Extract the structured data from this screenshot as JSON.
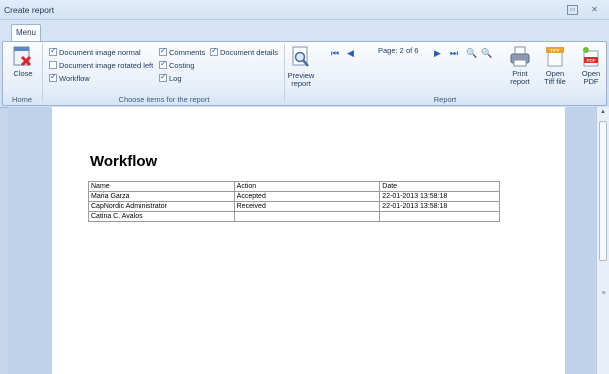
{
  "window": {
    "title": "Create report"
  },
  "ribbon_tabs": [
    {
      "label": "Menu"
    }
  ],
  "home_group": {
    "close_label": "Close",
    "group_label": "Home"
  },
  "items_group": {
    "group_label": "Choose items for the report",
    "checkboxes": [
      {
        "label": "Document image normal",
        "checked": true
      },
      {
        "label": "Document image rotated left",
        "checked": false
      },
      {
        "label": "Workflow",
        "checked": true
      },
      {
        "label": "Comments",
        "checked": true
      },
      {
        "label": "Costing",
        "checked": true
      },
      {
        "label": "Log",
        "checked": true
      },
      {
        "label": "Document details",
        "checked": true
      }
    ]
  },
  "report_group": {
    "group_label": "Report",
    "preview_label": "Preview report",
    "page_indicator": "Page: 2 of 6",
    "print_label": "Print report",
    "open_tiff_label": "Open Tiff file",
    "open_pdf_label": "Open PDF",
    "tiff_icon_text": "TIFF",
    "pdf_icon_text": "PDF"
  },
  "report": {
    "title": "Workflow",
    "columns": [
      "Name",
      "Action",
      "Date"
    ],
    "rows": [
      [
        "Maria Garza",
        "Accepted",
        "22-01-2013 13:58:18"
      ],
      [
        "CapNordic Administrator",
        "Received",
        "22-01-2013 13:58:18"
      ],
      [
        "Catina C. Avalos",
        "",
        ""
      ]
    ]
  },
  "colors": {
    "accent": "#2c5fa8",
    "ribbon_border": "#9bb3d2",
    "pdf_red": "#d0312d"
  }
}
